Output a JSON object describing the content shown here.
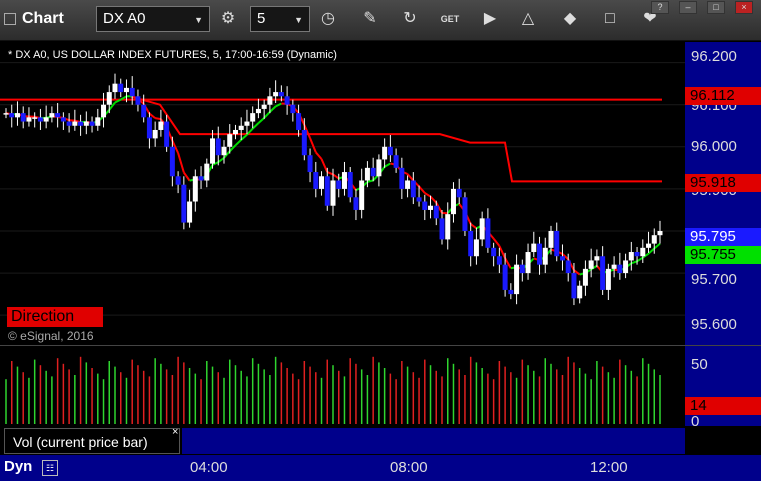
{
  "toolbar": {
    "title": "Chart",
    "symbol": "DX A0",
    "interval": "5",
    "icons": [
      "link-icon",
      "interval-icon",
      "pencil-icon",
      "refresh-icon",
      "get-icon",
      "play-icon",
      "alert-icon",
      "tag-icon",
      "chat-icon",
      "twitter-icon"
    ],
    "get_label": "GET"
  },
  "window_controls": [
    "?",
    "–",
    "□",
    "×"
  ],
  "chart": {
    "header": "* DX A0, US DOLLAR INDEX FUTURES, 5, 17:00-16:59 (Dynamic)",
    "direction_label": "Direction",
    "copyright": "© eSignal, 2016",
    "price_ticks": [
      "96.200",
      "96.100",
      "96.000",
      "95.900",
      "95.700",
      "95.600"
    ],
    "badges": [
      {
        "value": "96.112",
        "bg": "#e00000",
        "fg": "#000000"
      },
      {
        "value": "95.918",
        "bg": "#e00000",
        "fg": "#000000"
      },
      {
        "value": "95.795",
        "bg": "#1a1aff",
        "fg": "#ffffff"
      },
      {
        "value": "95.755",
        "bg": "#00e000",
        "fg": "#000000"
      }
    ]
  },
  "volume": {
    "legend": "Vol (current price bar)",
    "close_label": "×",
    "ticks": [
      "50",
      "0"
    ],
    "badge": "14"
  },
  "time_axis": {
    "mode_label": "Dyn",
    "ticks": [
      "04:00",
      "08:00",
      "12:00"
    ]
  },
  "colors": {
    "up": "#ffffff",
    "down": "#1a1aff",
    "ma_red": "#ff0000",
    "ma_green": "#00dd00",
    "panel": "#00008b"
  },
  "chart_data": {
    "type": "candlestick",
    "y_range": [
      95.56,
      96.23
    ],
    "closes": [
      96.08,
      96.07,
      96.08,
      96.06,
      96.07,
      96.07,
      96.06,
      96.07,
      96.08,
      96.07,
      96.06,
      96.05,
      96.06,
      96.05,
      96.06,
      96.05,
      96.07,
      96.1,
      96.13,
      96.15,
      96.13,
      96.14,
      96.12,
      96.1,
      96.07,
      96.02,
      96.04,
      96.06,
      96.0,
      95.93,
      95.91,
      95.82,
      95.87,
      95.93,
      95.92,
      95.96,
      96.02,
      95.98,
      96.0,
      96.03,
      96.04,
      96.05,
      96.06,
      96.08,
      96.09,
      96.1,
      96.12,
      96.13,
      96.12,
      96.1,
      96.08,
      96.04,
      95.98,
      95.94,
      95.9,
      95.93,
      95.86,
      95.92,
      95.9,
      95.94,
      95.88,
      95.85,
      95.92,
      95.95,
      95.93,
      95.97,
      96.0,
      95.98,
      95.95,
      95.9,
      95.92,
      95.88,
      95.87,
      95.85,
      95.86,
      95.83,
      95.78,
      95.84,
      95.9,
      95.88,
      95.8,
      95.74,
      95.78,
      95.83,
      95.76,
      95.74,
      95.72,
      95.66,
      95.65,
      95.72,
      95.7,
      95.75,
      95.77,
      95.72,
      95.76,
      95.8,
      95.74,
      95.73,
      95.7,
      95.64,
      95.67,
      95.71,
      95.73,
      95.74,
      95.66,
      95.71,
      95.72,
      95.7,
      95.73,
      95.75,
      95.74,
      95.76,
      95.77,
      95.79,
      95.8
    ],
    "ma_red_price": [
      96.11,
      96.11,
      96.11,
      96.11,
      96.11,
      96.11,
      96.11,
      96.11,
      96.11,
      96.11,
      96.11,
      96.11,
      96.11,
      96.11,
      96.11,
      96.11,
      96.11,
      96.11,
      96.11,
      96.11,
      96.11,
      96.11,
      96.11,
      96.11,
      96.11,
      96.11,
      96.11,
      96.11,
      96.11,
      96.11,
      96.11,
      96.11,
      96.11,
      96.11,
      96.11,
      96.11,
      96.11,
      96.11,
      96.11,
      96.11,
      96.11,
      96.11,
      96.11,
      96.11,
      96.11,
      96.11,
      96.11,
      96.11,
      96.11,
      96.11,
      96.11,
      96.11,
      96.11,
      96.11,
      96.11,
      96.11,
      96.11,
      96.11,
      96.11,
      96.11,
      96.11,
      96.11,
      96.11,
      96.11,
      96.11,
      96.11,
      96.11,
      96.11,
      96.11,
      96.11,
      96.11,
      96.11,
      96.11,
      96.11,
      96.11,
      96.11,
      96.11,
      96.11,
      96.11,
      96.11,
      96.11,
      96.11,
      96.11,
      96.11,
      96.11,
      96.11,
      96.11,
      96.11,
      96.11,
      96.11,
      96.11,
      96.11,
      96.11,
      96.11,
      96.11,
      96.11,
      96.11,
      96.11,
      96.11,
      96.11,
      96.11,
      96.11,
      96.11,
      96.11,
      96.11,
      96.11,
      96.11,
      96.11,
      96.11,
      96.11,
      96.11,
      96.11,
      96.11,
      96.11,
      96.11,
      96.11
    ],
    "volume_max": 50
  }
}
